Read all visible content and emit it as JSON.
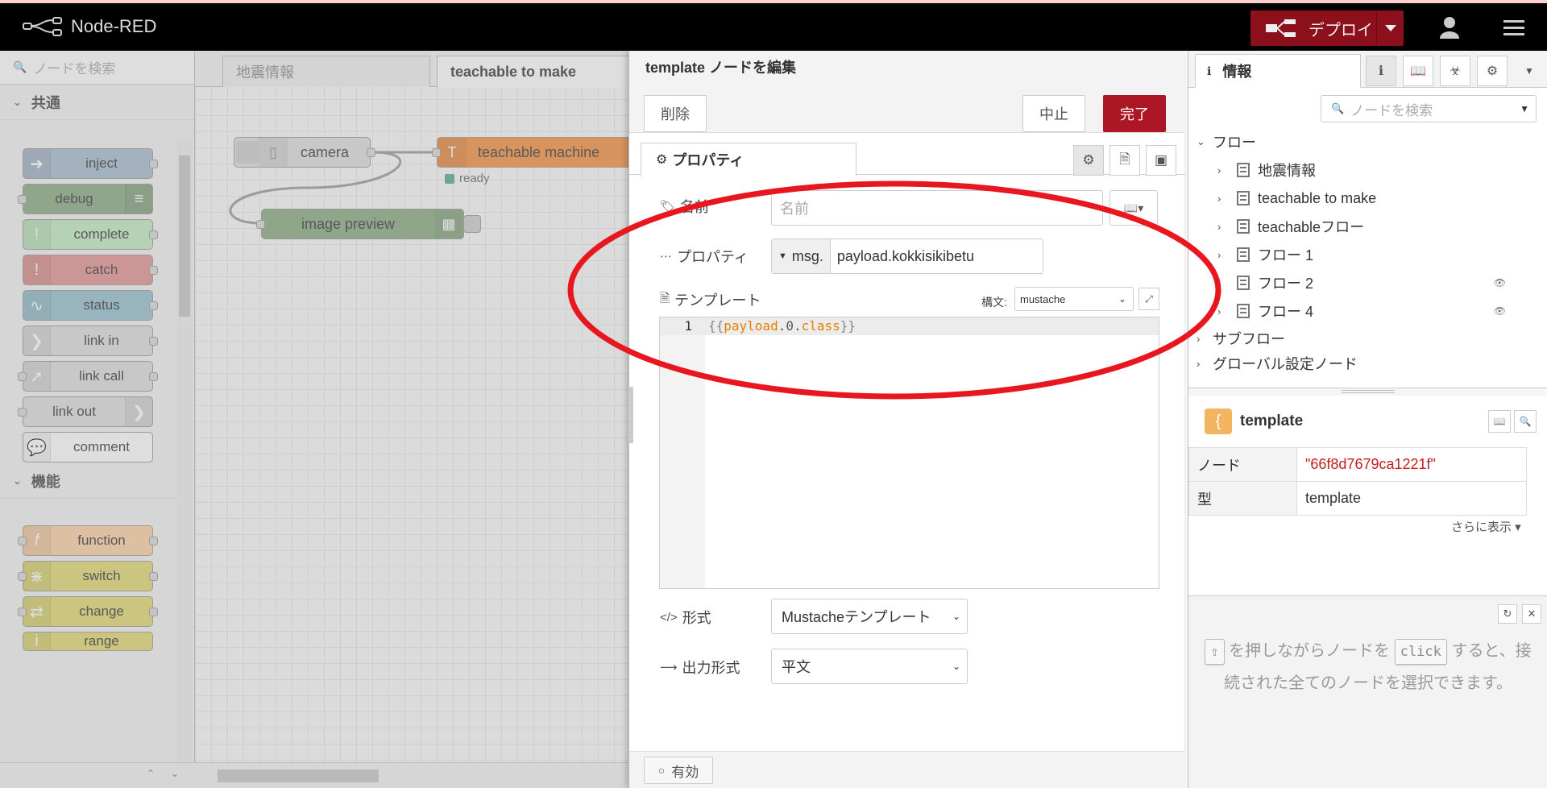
{
  "header": {
    "app_title": "Node-RED",
    "deploy_label": "デプロイ"
  },
  "palette": {
    "search_placeholder": "ノードを検索",
    "categories": [
      {
        "label": "共通",
        "nodes": [
          "inject",
          "debug",
          "complete",
          "catch",
          "status",
          "link in",
          "link call",
          "link out",
          "comment"
        ]
      },
      {
        "label": "機能",
        "nodes": [
          "function",
          "switch",
          "change",
          "range"
        ]
      }
    ],
    "colors": {
      "inject": "#a6bbcf",
      "debug": "#87a980",
      "complete": "#c0edc0",
      "catch": "#e49191",
      "status": "#94c1d0",
      "link": "#dddddd",
      "comment": "#ffffff",
      "function": "#fdd0a2",
      "switch": "#e2d96e",
      "change": "#e2d96e",
      "range": "#e2d96e"
    }
  },
  "workspace": {
    "tabs": [
      "地震情報",
      "teachable to make"
    ],
    "active_tab": "teachable to make",
    "nodes": {
      "camera": "camera",
      "teachable": "teachable machine",
      "teachable_status": "ready",
      "image_preview": "image preview"
    }
  },
  "tray": {
    "title": "template ノードを編集",
    "delete_label": "削除",
    "cancel_label": "中止",
    "done_label": "完了",
    "properties_tab": "プロパティ",
    "name_label": "名前",
    "name_placeholder": "名前",
    "property_label": "プロパティ",
    "property_prefix": "msg.",
    "property_value": "payload.kokkisikibetu",
    "template_label": "テンプレート",
    "syntax_label": "構文:",
    "syntax_value": "mustache",
    "code_line_number": "1",
    "code": {
      "open": "{{",
      "payload": "payload",
      "dot1": ".0.",
      "cls": "class",
      "close": "}}"
    },
    "format_label": "形式",
    "format_value": "Mustacheテンプレート",
    "output_label": "出力形式",
    "output_value": "平文",
    "enabled_label": "有効"
  },
  "sidebar": {
    "tab_label": "情報",
    "search_placeholder": "ノードを検索",
    "tree": {
      "flows_label": "フロー",
      "flows": [
        "地震情報",
        "teachable to make",
        "teachableフロー",
        "フロー 1",
        "フロー 2",
        "フロー 4"
      ],
      "subflows_label": "サブフロー",
      "global_label": "グローバル設定ノード"
    },
    "selected_node": {
      "icon": "{",
      "name": "template",
      "node_key": "ノード",
      "node_value": "\"66f8d7679ca1221f\"",
      "type_key": "型",
      "type_value": "template",
      "more_label": "さらに表示 ▾"
    },
    "help": {
      "part1": "を押しながらノードを",
      "kbd_shift": "⇧",
      "kbd_click": "click",
      "part2": "すると、接続された全てのノードを選択できます。"
    }
  },
  "annotation_color": "#e8161e"
}
